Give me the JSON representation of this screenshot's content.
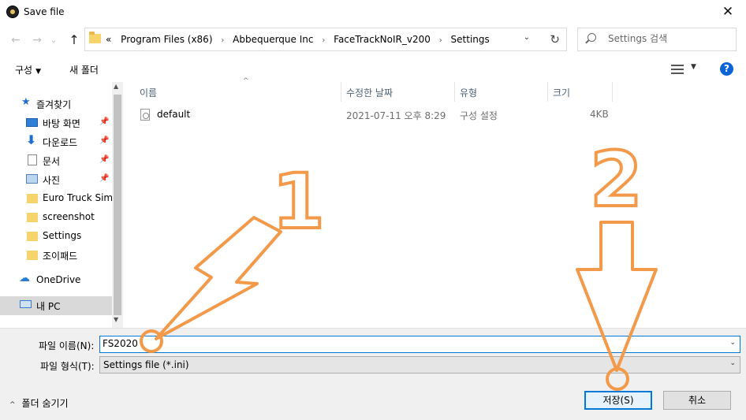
{
  "window": {
    "title": "Save file",
    "close_glyph": "✕"
  },
  "nav": {
    "back_glyph": "←",
    "forward_glyph": "→",
    "recent_glyph": "⌄",
    "up_glyph": "↑"
  },
  "address": {
    "prefix": "«",
    "crumbs": [
      "Program Files (x86)",
      "Abbequerque Inc",
      "FaceTrackNoIR_v200",
      "Settings"
    ],
    "separator": "›",
    "dropdown_glyph": "⌄",
    "refresh_glyph": "↻"
  },
  "search": {
    "placeholder": "Settings 검색"
  },
  "toolbar": {
    "organize": "구성",
    "organize_caret": "▼",
    "new_folder": "새 폴더",
    "view_caret": "▼",
    "help": "?"
  },
  "sidebar": {
    "items": [
      {
        "label": "즐겨찾기",
        "icon": "star-icon",
        "pinned": false
      },
      {
        "label": "바탕 화면",
        "icon": "desktop-icon",
        "pinned": true
      },
      {
        "label": "다운로드",
        "icon": "download-icon",
        "pinned": true
      },
      {
        "label": "문서",
        "icon": "document-icon",
        "pinned": true
      },
      {
        "label": "사진",
        "icon": "pictures-icon",
        "pinned": true
      },
      {
        "label": "Euro Truck Simu",
        "icon": "folder-icon",
        "pinned": false
      },
      {
        "label": "screenshot",
        "icon": "folder-icon",
        "pinned": false
      },
      {
        "label": "Settings",
        "icon": "folder-icon",
        "pinned": false
      },
      {
        "label": "조이패드",
        "icon": "folder-icon",
        "pinned": false
      },
      {
        "label": "OneDrive",
        "icon": "onedrive-icon",
        "pinned": false
      },
      {
        "label": "내 PC",
        "icon": "pc-icon",
        "pinned": false,
        "selected": true
      }
    ],
    "pin_glyph": "📌"
  },
  "file_list": {
    "columns": [
      "이름",
      "수정한 날짜",
      "유형",
      "크기"
    ],
    "sort_glyph": "^",
    "rows": [
      {
        "name": "default",
        "modified": "2021-07-11 오후 8:29",
        "type": "구성 설정",
        "size": "4KB"
      }
    ]
  },
  "form": {
    "filename_label": "파일 이름(N):",
    "filename_value": "FS2020",
    "filetype_label": "파일 형식(T):",
    "filetype_value": "Settings file (*.ini)",
    "dropdown_glyph": "⌄"
  },
  "footer": {
    "hide_folders": "폴더 숨기기",
    "hide_caret": "^",
    "save": "저장(S)",
    "cancel": "취소"
  },
  "annotations": {
    "label_1": "1",
    "label_2": "2",
    "color": "#f29a4a"
  }
}
